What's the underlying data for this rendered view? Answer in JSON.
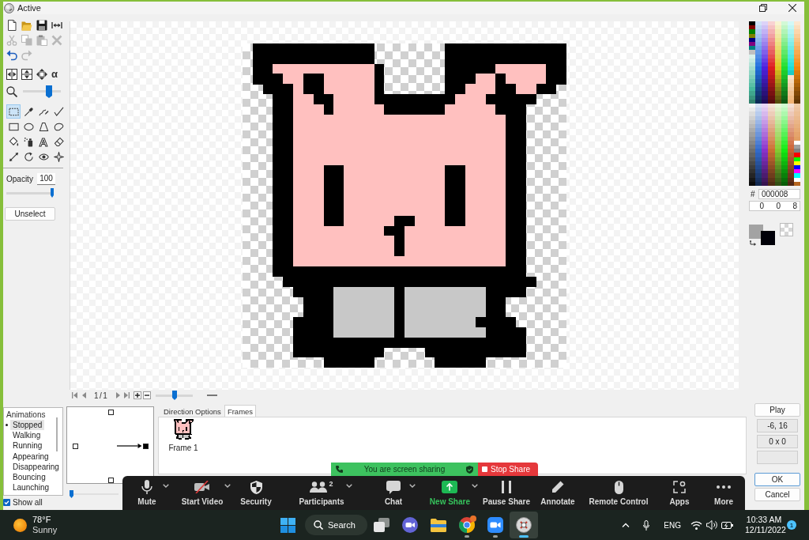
{
  "window": {
    "title": "Active"
  },
  "edit_tools": [
    {
      "disabled": false
    },
    {
      "disabled": false
    },
    {
      "disabled": false
    },
    {
      "disabled": false
    },
    {
      "disabled": true
    },
    {
      "disabled": true
    },
    {
      "disabled": true
    },
    {
      "disabled": true
    },
    {
      "disabled": false
    },
    {
      "disabled": true
    }
  ],
  "alpha_tool": "α",
  "zoom": {
    "level": 0.72
  },
  "draw_tools": [
    {
      "selected": true
    },
    {
      "selected": false
    },
    {
      "selected": false
    },
    {
      "selected": false
    },
    {
      "selected": false
    },
    {
      "selected": false
    },
    {
      "selected": false
    },
    {
      "selected": false
    },
    {
      "selected": false
    },
    {
      "selected": false
    },
    {
      "label": "A",
      "selected": false
    },
    {
      "selected": false
    },
    {
      "selected": false
    },
    {
      "selected": false
    },
    {
      "selected": false
    },
    {
      "selected": false
    }
  ],
  "opacity": {
    "label": "Opacity",
    "value": "100",
    "level": 1
  },
  "unselect_button": "Unselect",
  "palette": {
    "hex_label": "#",
    "hex": "000008",
    "rgb": [
      "0",
      "0",
      "8"
    ]
  },
  "swatches": [
    {
      "color": "#a3a3a3"
    },
    {
      "color": "#000008"
    }
  ],
  "frame_nav": {
    "counter": "1/1",
    "level": 0.5
  },
  "animations": {
    "title": "Animations",
    "items": [
      {
        "label": "Stopped",
        "selected": true
      },
      {
        "label": "Walking",
        "selected": false
      },
      {
        "label": "Running",
        "selected": false
      },
      {
        "label": "Appearing",
        "selected": false
      },
      {
        "label": "Disappearing",
        "selected": false
      },
      {
        "label": "Bouncing",
        "selected": false
      },
      {
        "label": "Launching",
        "selected": false
      }
    ],
    "show_all": {
      "label": "Show all",
      "checked": true
    }
  },
  "directions": {
    "items": [
      {
        "selected": false
      },
      {
        "selected": false
      },
      {
        "selected": false
      },
      {
        "selected": true
      }
    ],
    "level": 0
  },
  "tabs": [
    {
      "label": "Direction Options",
      "selected": false
    },
    {
      "label": "Frames",
      "selected": true
    }
  ],
  "frames": [
    {
      "label": "Frame 1"
    }
  ],
  "side_panel": {
    "play": "Play",
    "position": "-6, 16",
    "size": "0 x 0",
    "ok": "OK",
    "cancel": "Cancel"
  },
  "sharing": {
    "notice": "You are screen sharing",
    "stop": "Stop Share",
    "tools": [
      {
        "label": "Mute",
        "menu": true,
        "highlighted": false
      },
      {
        "label": "Start Video",
        "menu": true,
        "highlighted": false
      },
      {
        "label": "Security",
        "menu": false,
        "highlighted": false
      },
      {
        "label": "Participants",
        "count": "2",
        "menu": true,
        "highlighted": false
      },
      {
        "label": "Chat",
        "menu": true,
        "highlighted": false
      },
      {
        "label": "New Share",
        "menu": true,
        "highlighted": true
      },
      {
        "label": "Pause Share",
        "menu": false,
        "highlighted": false
      },
      {
        "label": "Annotate",
        "menu": false,
        "highlighted": false
      },
      {
        "label": "Remote Control",
        "menu": false,
        "highlighted": false
      },
      {
        "label": "Apps",
        "menu": false,
        "highlighted": false
      },
      {
        "label": "More",
        "menu": false,
        "highlighted": false
      }
    ]
  },
  "taskbar": {
    "weather": {
      "temperature": "78°F",
      "condition": "Sunny"
    },
    "search": "Search",
    "apps": [
      {
        "running": false,
        "active": false
      },
      {
        "running": false,
        "active": false
      },
      {
        "running": false,
        "active": false
      },
      {
        "running": true,
        "active": false
      },
      {
        "running": true,
        "active": false
      },
      {
        "running": true,
        "active": true
      }
    ],
    "language": "ENG",
    "time": "10:33 AM",
    "date": "12/11/2022",
    "notifications": "1"
  }
}
